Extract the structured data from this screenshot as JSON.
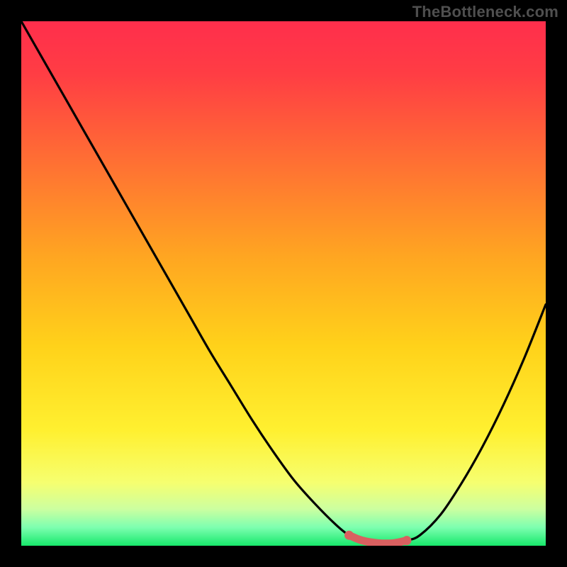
{
  "watermark": "TheBottleneck.com",
  "colors": {
    "curve": "#000000",
    "marker": "#d96060",
    "background_top": "#ff2e4c",
    "background_bottom": "#17e86b"
  },
  "chart_data": {
    "type": "line",
    "title": "",
    "xlabel": "",
    "ylabel": "",
    "xlim": [
      0,
      100
    ],
    "ylim": [
      0,
      100
    ],
    "series": [
      {
        "name": "bottleneck_curve",
        "x": [
          0,
          4,
          8,
          12,
          16,
          20,
          24,
          28,
          32,
          36,
          40,
          44,
          48,
          52,
          56,
          60,
          62.5,
          65,
          68,
          71,
          73.5,
          76,
          80,
          84,
          88,
          92,
          96,
          100
        ],
        "y": [
          100,
          93,
          86,
          79,
          72,
          65,
          58,
          51,
          44,
          37,
          30.5,
          24,
          18,
          12.5,
          8,
          4,
          2,
          1,
          0.5,
          0.5,
          1,
          2,
          6,
          12,
          19,
          27,
          36,
          46
        ]
      }
    ],
    "markers": {
      "name": "optimal_range",
      "x": [
        62.5,
        65,
        68,
        71,
        73.5
      ],
      "y": [
        2,
        1,
        0.5,
        0.5,
        1
      ]
    },
    "marker_endpoints": {
      "x": [
        62.5,
        73.5
      ],
      "y": [
        2,
        1
      ]
    }
  }
}
